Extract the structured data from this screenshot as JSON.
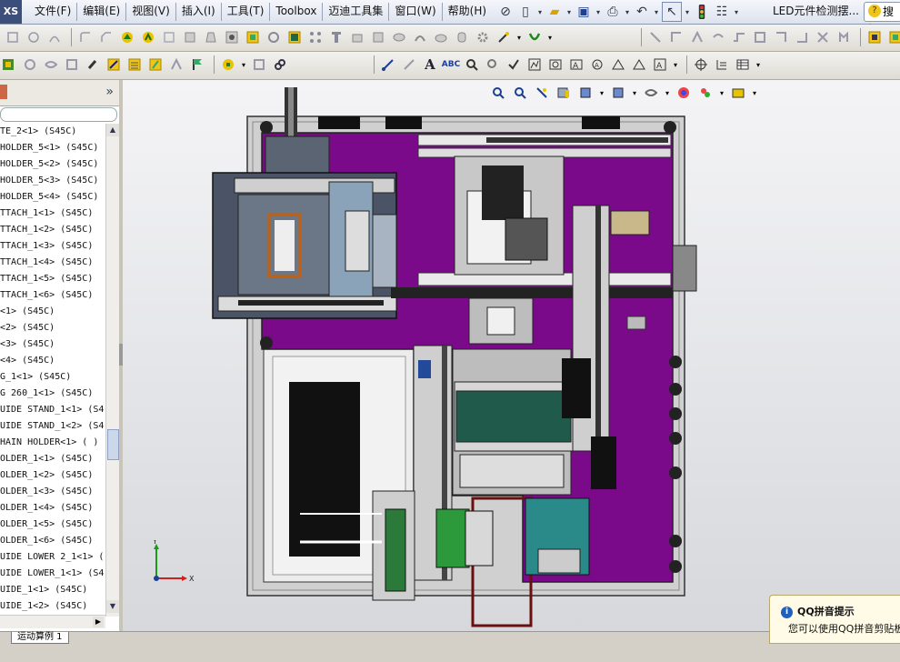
{
  "app": {
    "logo_text": "XS"
  },
  "menu": {
    "items": [
      "文件(F)",
      "编辑(E)",
      "视图(V)",
      "插入(I)",
      "工具(T)",
      "Toolbox",
      "迈迪工具集",
      "窗口(W)",
      "帮助(H)"
    ]
  },
  "title_area": {
    "document_title": "LED元件检测摆...",
    "search_label": "搜索"
  },
  "sidebar": {
    "items": [
      "TE_2<1> (S45C)",
      " HOLDER_5<1> (S45C)",
      " HOLDER_5<2> (S45C)",
      " HOLDER_5<3> (S45C)",
      " HOLDER_5<4> (S45C)",
      "TTACH_1<1> (S45C)",
      "TTACH_1<2> (S45C)",
      "TTACH_1<3> (S45C)",
      "TTACH_1<4> (S45C)",
      "TTACH_1<5> (S45C)",
      "TTACH_1<6> (S45C)",
      "<1> (S45C)",
      "<2> (S45C)",
      "<3> (S45C)",
      "<4> (S45C)",
      "G_1<1> (S45C)",
      "G 260_1<1> (S45C)",
      "UIDE STAND_1<1> (S4",
      "UIDE STAND_1<2> (S4",
      "HAIN HOLDER<1> ( )",
      "OLDER_1<1> (S45C)",
      "OLDER_1<2> (S45C)",
      "OLDER_1<3> (S45C)",
      "OLDER_1<4> (S45C)",
      "OLDER_1<5> (S45C)",
      "OLDER_1<6> (S45C)",
      "UIDE LOWER 2_1<1> (",
      "UIDE LOWER_1<1> (S4",
      "UIDE_1<1> (S45C)",
      "UIDE_1<2> (S45C)"
    ]
  },
  "statusbar": {
    "tab_label": "运动算例 1"
  },
  "toast": {
    "title": "QQ拼音提示",
    "body": "您可以使用QQ拼音剪贴板"
  },
  "axes": {
    "x_label": "X",
    "y_label": "Y"
  },
  "colors": {
    "frame_purple": "#7a0a8a",
    "rail_gray": "#c8c8c8",
    "plate_dark": "#4a5466"
  }
}
